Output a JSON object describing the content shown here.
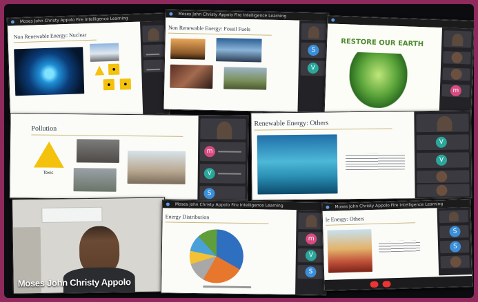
{
  "meeting": {
    "header_text": "Moses John Christy Appolo Fire Intelligence Learning",
    "participant_name": "Moses John Christy Appolo"
  },
  "slides": {
    "nuclear": {
      "title": "Non Renewable Energy: Nuclear"
    },
    "fossil": {
      "title": "Non Renewable Energy: Fossil Fuels"
    },
    "restore": {
      "title": "RESTORE OUR EARTH"
    },
    "pollution": {
      "title": "Pollution",
      "caption": "Toxic"
    },
    "others": {
      "title": "Renewable Energy: Others"
    },
    "distribution": {
      "title": "Energy Distribution"
    },
    "others2": {
      "title": "le Energy: Others"
    }
  },
  "avatars": {
    "s": "S",
    "v": "V",
    "m": "m"
  },
  "colors": {
    "accent": "#8e2a5c",
    "frame": "#0c0c10",
    "video_bg": "#232327"
  }
}
